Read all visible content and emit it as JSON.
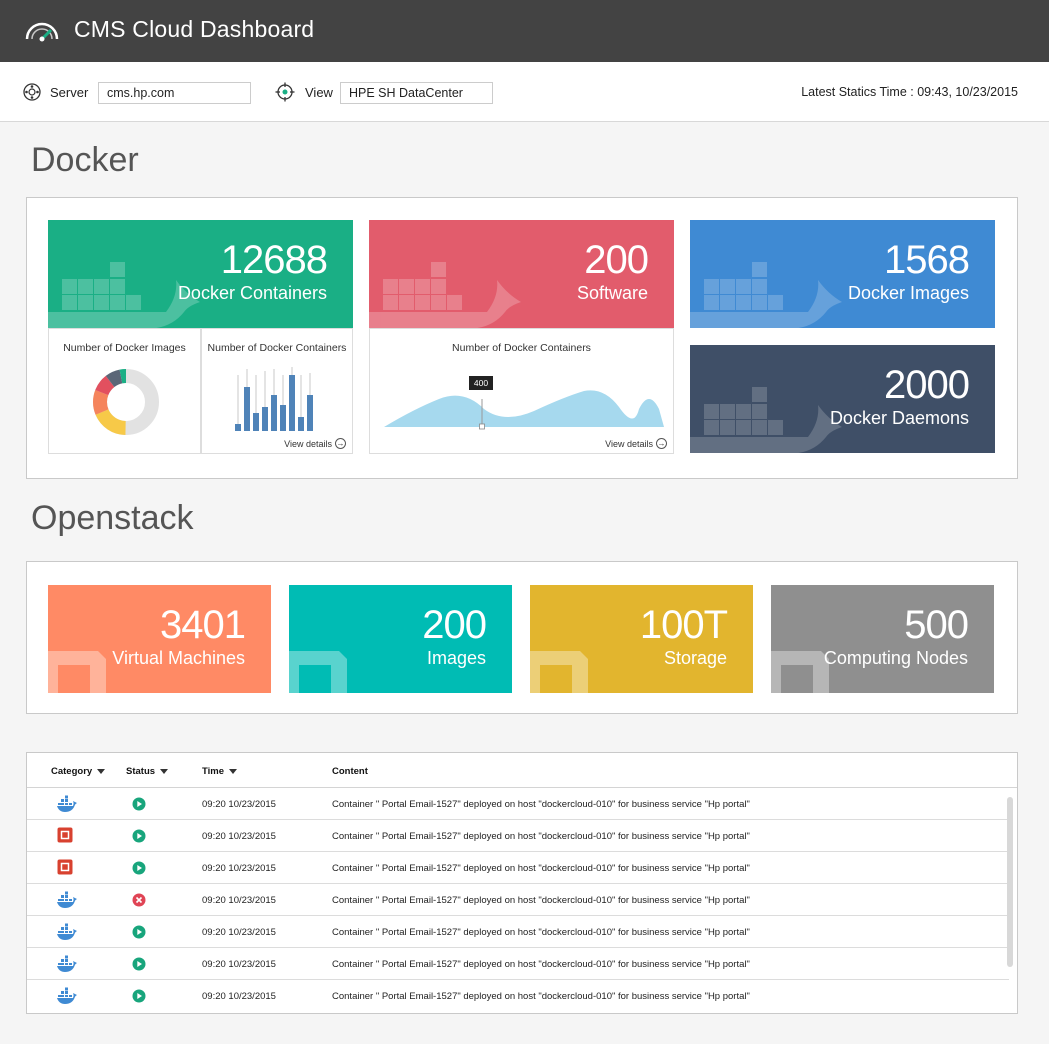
{
  "app": {
    "title": "CMS Cloud Dashboard"
  },
  "filters": {
    "server_label": "Server",
    "server_value": "cms.hp.com",
    "view_label": "View",
    "view_value": "HPE SH DataCenter",
    "latest_time": "Latest Statics Time : 09:43, 10/23/2015"
  },
  "docker": {
    "section_title": "Docker",
    "tiles": [
      {
        "value": "12688",
        "label": "Docker Containers",
        "color": "#1aaf85"
      },
      {
        "value": "200",
        "label": "Software",
        "color": "#e25c6c"
      },
      {
        "value": "1568",
        "label": "Docker Images",
        "color": "#3f8ad3"
      },
      {
        "value": "2000",
        "label": "Docker Daemons",
        "color": "#3f4f67"
      }
    ],
    "sub_charts": {
      "images_title": "Number of Docker Images",
      "containers_title": "Number of Docker Containers",
      "software_chart_title": "Number of Docker Containers",
      "view_details": "View details",
      "tooltip_value": "400"
    }
  },
  "openstack": {
    "section_title": "Openstack",
    "tiles": [
      {
        "value": "3401",
        "label": "Virtual Machines",
        "color": "#ff8a65"
      },
      {
        "value": "200",
        "label": "Images",
        "color": "#00bcb4"
      },
      {
        "value": "100T",
        "label": "Storage",
        "color": "#e2b52e"
      },
      {
        "value": "500",
        "label": "Computing Nodes",
        "color": "#8f8f8f"
      }
    ]
  },
  "events": {
    "columns": [
      "Category",
      "Status",
      "Time",
      "Content"
    ],
    "rows": [
      {
        "category": "docker-icon",
        "status": "running-icon",
        "time": "09:20 10/23/2015",
        "content": "Container \" Portal Email-1527\" deployed on host \"dockercloud-010\" for business service \"Hp portal\""
      },
      {
        "category": "openstack-icon",
        "status": "running-icon",
        "time": "09:20 10/23/2015",
        "content": "Container \" Portal Email-1527\" deployed on host \"dockercloud-010\" for business service \"Hp portal\""
      },
      {
        "category": "openstack-icon",
        "status": "running-icon",
        "time": "09:20 10/23/2015",
        "content": "Container \" Portal Email-1527\" deployed on host \"dockercloud-010\" for business service \"Hp portal\""
      },
      {
        "category": "docker-icon",
        "status": "error-icon",
        "time": "09:20 10/23/2015",
        "content": "Container \" Portal Email-1527\" deployed on host \"dockercloud-010\" for business service \"Hp portal\""
      },
      {
        "category": "docker-icon",
        "status": "running-icon",
        "time": "09:20 10/23/2015",
        "content": "Container \" Portal Email-1527\" deployed on host \"dockercloud-010\" for business service \"Hp portal\""
      },
      {
        "category": "docker-icon",
        "status": "running-icon",
        "time": "09:20 10/23/2015",
        "content": "Container \" Portal Email-1527\" deployed on host \"dockercloud-010\" for business service \"Hp portal\""
      },
      {
        "category": "docker-icon",
        "status": "running-icon",
        "time": "09:20 10/23/2015",
        "content": "Container \" Portal Email-1527\" deployed on host \"dockercloud-010\" for business service \"Hp portal\""
      }
    ]
  },
  "colors": {
    "status_running": "#18a57c",
    "status_error": "#e04455",
    "docker_icon": "#3f8ad3",
    "openstack_icon": "#d8412f"
  }
}
